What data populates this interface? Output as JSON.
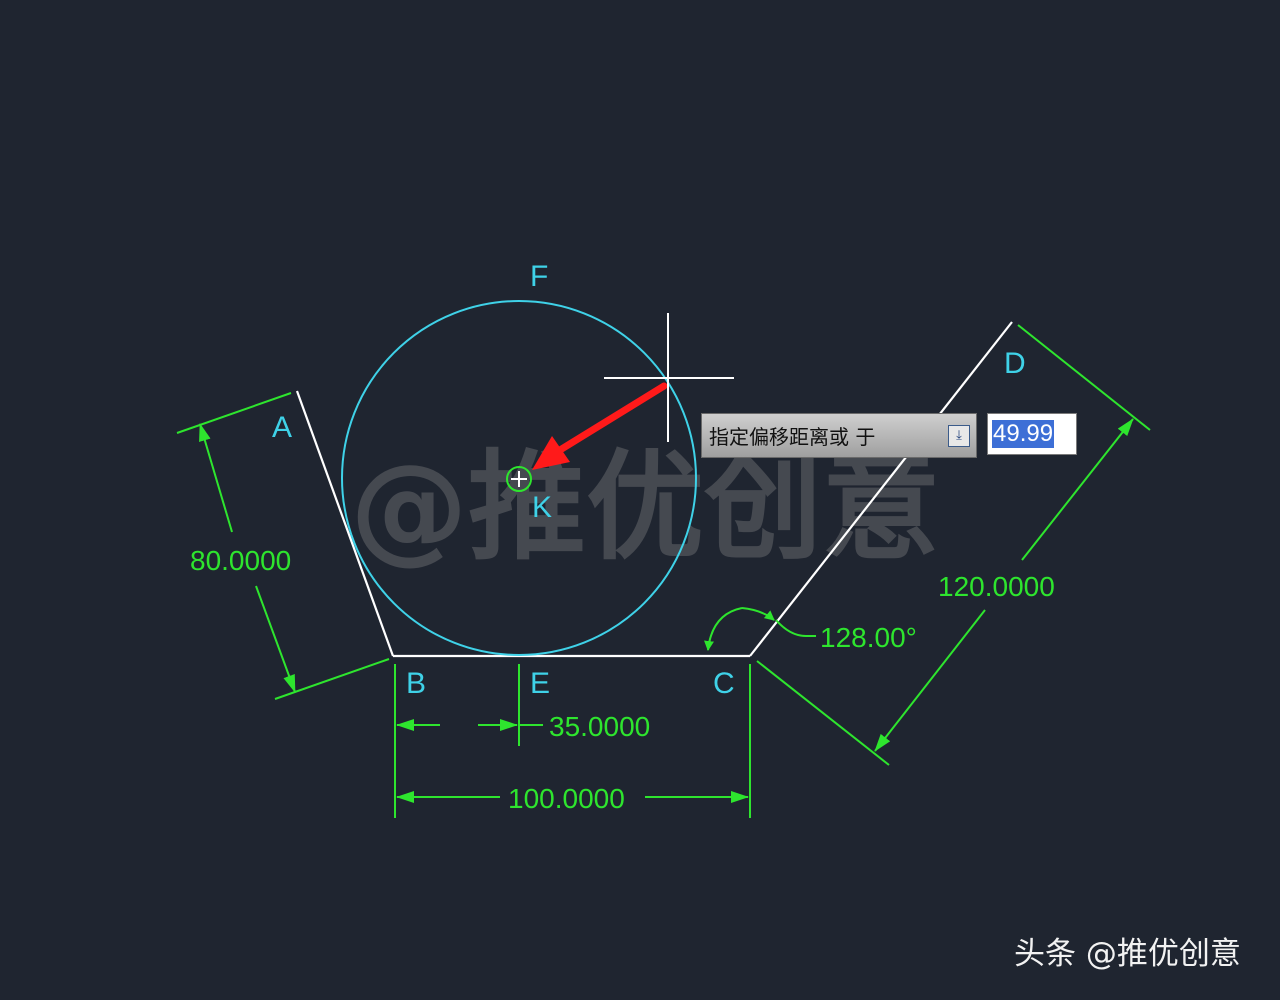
{
  "points": {
    "a": "A",
    "b": "B",
    "c": "C",
    "d": "D",
    "e": "E",
    "f": "F",
    "k": "K"
  },
  "dimensions": {
    "left_side": "80.0000",
    "bottom_offset": "35.0000",
    "bottom_total": "100.0000",
    "right_side": "120.0000",
    "angle": "128.00°"
  },
  "command_prompt": {
    "text": "指定偏移距离或 于",
    "dropdown_icon": "dropdown-arrow-icon",
    "value": "49.99"
  },
  "watermark": {
    "center": "@推优创意",
    "corner": "头条 @推优创意"
  },
  "colors": {
    "background": "#1f2530",
    "dimension": "#2ee52e",
    "circle": "#3fd2e8",
    "geometry": "#ffffff",
    "arrow": "#ff1a1a"
  }
}
